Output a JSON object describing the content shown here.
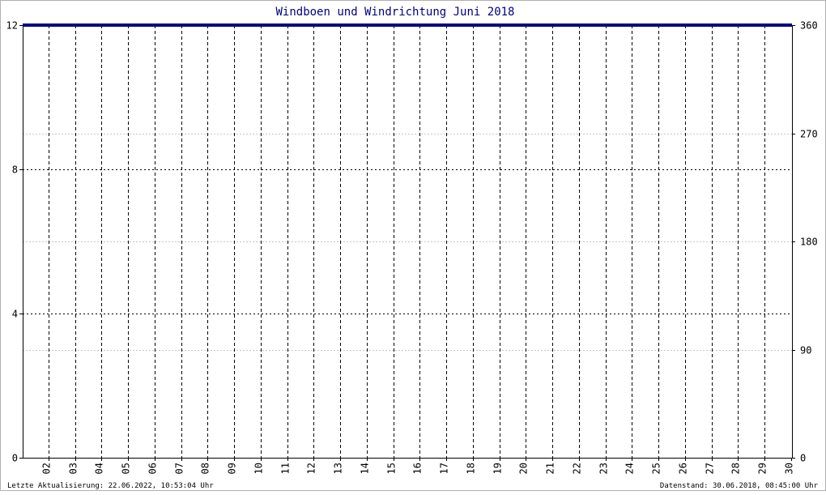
{
  "chart_data": {
    "type": "line",
    "title": "Windboen und Windrichtung Juni 2018",
    "x_tick_labels": [
      "02",
      "03",
      "04",
      "05",
      "06",
      "07",
      "08",
      "09",
      "10",
      "11",
      "12",
      "13",
      "14",
      "15",
      "16",
      "17",
      "18",
      "19",
      "20",
      "21",
      "22",
      "23",
      "24",
      "25",
      "26",
      "27",
      "28",
      "29",
      "30"
    ],
    "left_axis": {
      "ylim": [
        0,
        12
      ],
      "ticks": [
        "0",
        "4",
        "8",
        "12"
      ]
    },
    "right_axis": {
      "ylim": [
        0,
        360
      ],
      "ticks": [
        "0",
        "90",
        "180",
        "270",
        "360"
      ]
    },
    "series": [
      {
        "color": "#000080",
        "axis": "left",
        "values": [
          12,
          12,
          12,
          12,
          12,
          12,
          12,
          12,
          12,
          12,
          12,
          12,
          12,
          12,
          12,
          12,
          12,
          12,
          12,
          12,
          12,
          12,
          12,
          12,
          12,
          12,
          12,
          12,
          12,
          12
        ]
      }
    ],
    "grid": true
  },
  "footer": {
    "left": "Letzte Aktualisierung: 22.06.2022, 10:53:04 Uhr",
    "right": "Datenstand: 30.06.2018, 08:45:00 Uhr"
  }
}
